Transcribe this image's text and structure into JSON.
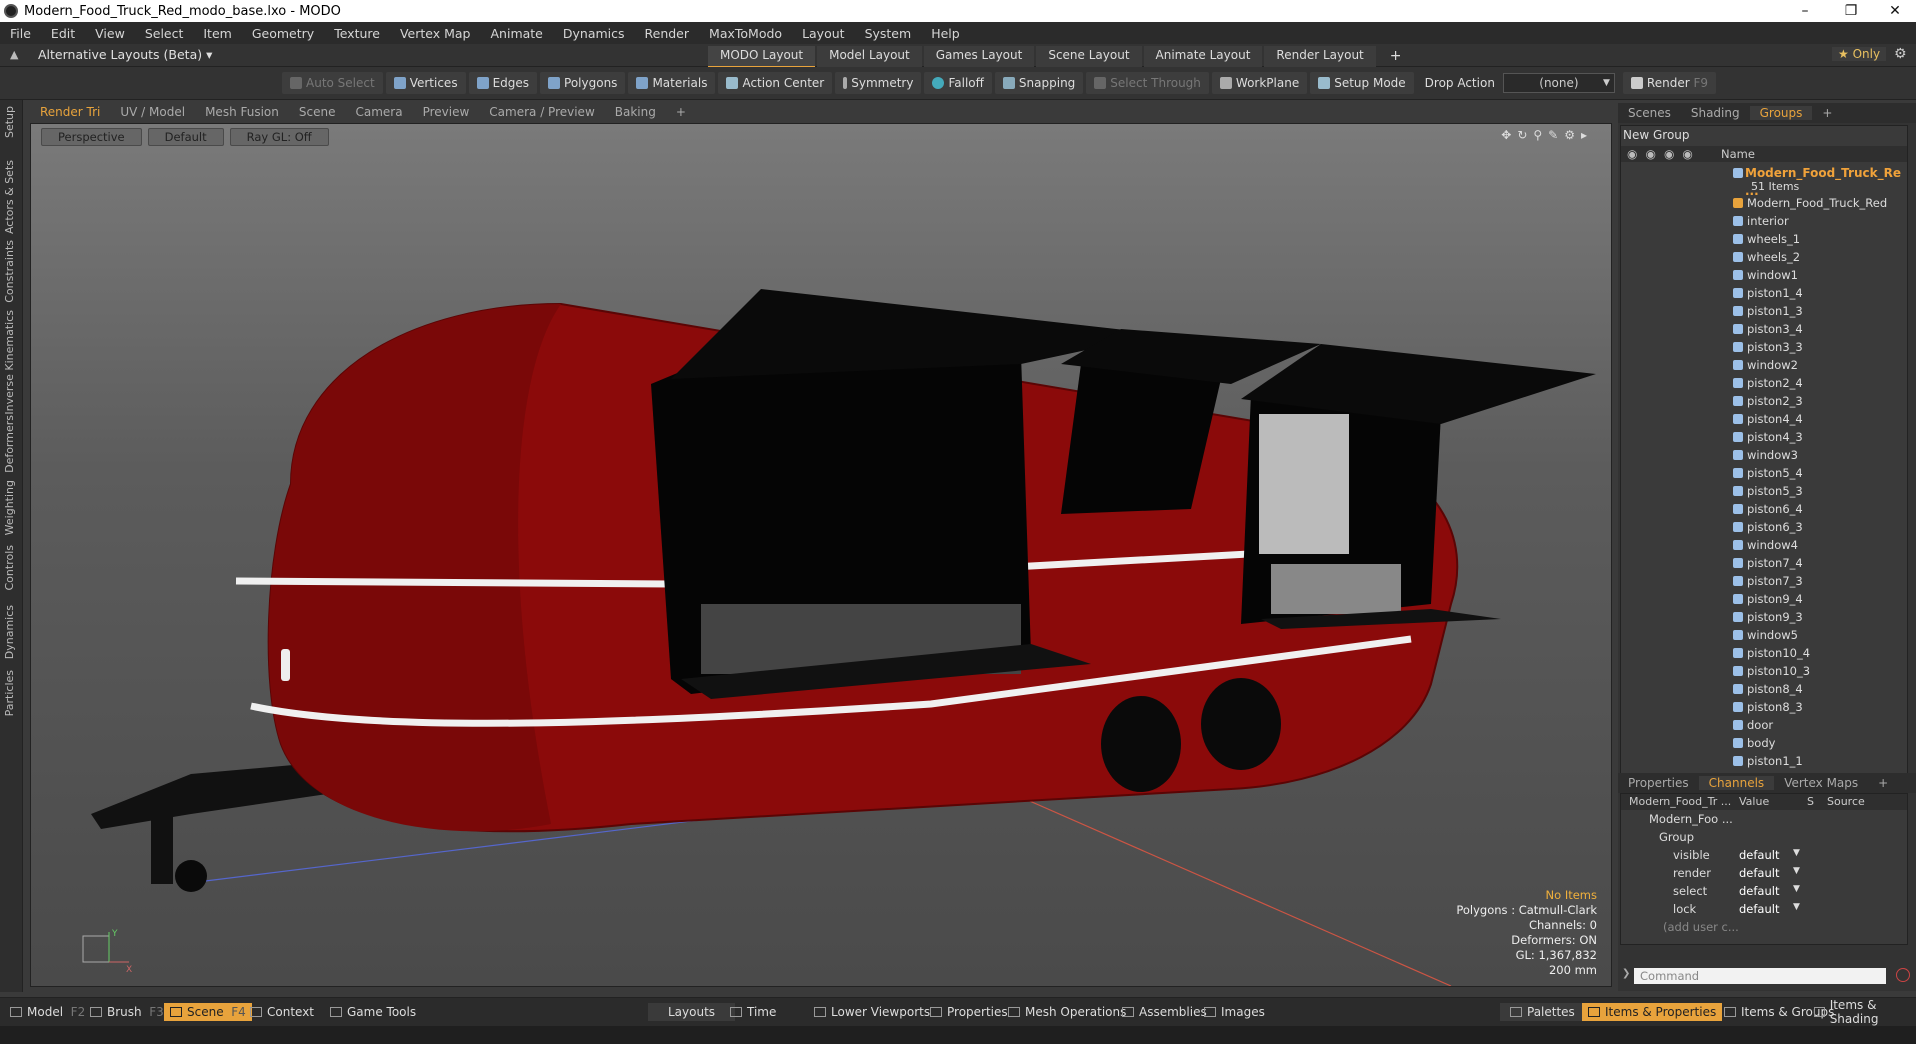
{
  "window": {
    "title": "Modern_Food_Truck_Red_modo_base.lxo - MODO"
  },
  "menu": [
    "File",
    "Edit",
    "View",
    "Select",
    "Item",
    "Geometry",
    "Texture",
    "Vertex Map",
    "Animate",
    "Dynamics",
    "Render",
    "MaxToModo",
    "Layout",
    "System",
    "Help"
  ],
  "layout_bar": {
    "alt_layouts": "Alternative Layouts (Beta) ▾",
    "tabs": [
      "MODO Layout",
      "Model Layout",
      "Games Layout",
      "Scene Layout",
      "Animate Layout",
      "Render Layout"
    ],
    "add": "+",
    "only": "★ Only"
  },
  "toolbar": {
    "auto_select": "Auto Select",
    "vertices": "Vertices",
    "edges": "Edges",
    "polygons": "Polygons",
    "materials": "Materials",
    "action_center": "Action Center",
    "symmetry": "Symmetry",
    "falloff": "Falloff",
    "snapping": "Snapping",
    "select_through": "Select Through",
    "workplane": "WorkPlane",
    "setup_mode": "Setup Mode",
    "drop_action": "Drop Action",
    "drop_value": "(none)",
    "render": "Render",
    "render_key": "F9"
  },
  "left_tabs": [
    "Setup",
    "Actors & Sets",
    "Constraints",
    "Inverse Kinematics",
    "Deformers",
    "Weighting",
    "Controls",
    "Dynamics",
    "Particles"
  ],
  "viewport": {
    "tabs": [
      "Render Tri",
      "UV / Model",
      "Mesh Fusion",
      "Scene",
      "Camera",
      "Preview",
      "Camera / Preview",
      "Baking",
      "+"
    ],
    "view": "Perspective",
    "shading": "Default",
    "raygl": "Ray GL: Off",
    "info": {
      "no_items": "No Items",
      "polygons": "Polygons : Catmull-Clark",
      "channels": "Channels: 0",
      "deformers": "Deformers: ON",
      "gl": "GL: 1,367,832",
      "scale": "200 mm"
    },
    "axis_y": "Y",
    "axis_x": "X"
  },
  "right_panel": {
    "tabs": [
      "Scenes",
      "Shading",
      "Groups",
      "+"
    ],
    "new_group": "New Group",
    "name_col": "Name",
    "root": "Modern_Food_Truck_Re ...",
    "root_count": "51 Items",
    "items": [
      "Modern_Food_Truck_Red",
      "interior",
      "wheels_1",
      "wheels_2",
      "window1",
      "piston1_4",
      "piston1_3",
      "piston3_4",
      "piston3_3",
      "window2",
      "piston2_4",
      "piston2_3",
      "piston4_4",
      "piston4_3",
      "window3",
      "piston5_4",
      "piston5_3",
      "piston6_4",
      "piston6_3",
      "window4",
      "piston7_4",
      "piston7_3",
      "piston9_4",
      "piston9_3",
      "window5",
      "piston10_4",
      "piston10_3",
      "piston8_4",
      "piston8_3",
      "door",
      "body",
      "piston1_1"
    ],
    "ch_tabs": [
      "Properties",
      "Channels",
      "Vertex Maps",
      "+"
    ],
    "ch_header": {
      "name": "Modern_Food_Tr ...",
      "value": "Value",
      "s": "S",
      "source": "Source"
    },
    "ch_item": "Modern_Foo ...",
    "ch_group": "Group",
    "channels": [
      {
        "name": "visible",
        "value": "default"
      },
      {
        "name": "render",
        "value": "default"
      },
      {
        "name": "select",
        "value": "default"
      },
      {
        "name": "lock",
        "value": "default"
      }
    ],
    "add_user": "(add user c...",
    "command_placeholder": "Command"
  },
  "bottom_bar": {
    "model": "Model",
    "model_key": "F2",
    "brush": "Brush",
    "brush_key": "F3",
    "scene": "Scene",
    "scene_key": "F4",
    "context": "Context",
    "game_tools": "Game Tools",
    "layouts": "Layouts",
    "time": "Time",
    "lower_viewports": "Lower Viewports",
    "properties": "Properties",
    "mesh_operations": "Mesh Operations",
    "assemblies": "Assemblies",
    "images": "Images",
    "palettes": "Palettes",
    "items_properties": "Items & Properties",
    "items_groups": "Items & Groups",
    "items_shading": "Items & Shading"
  },
  "colors": {
    "accent": "#e8a33c",
    "truck_body": "#8b0a0a"
  }
}
